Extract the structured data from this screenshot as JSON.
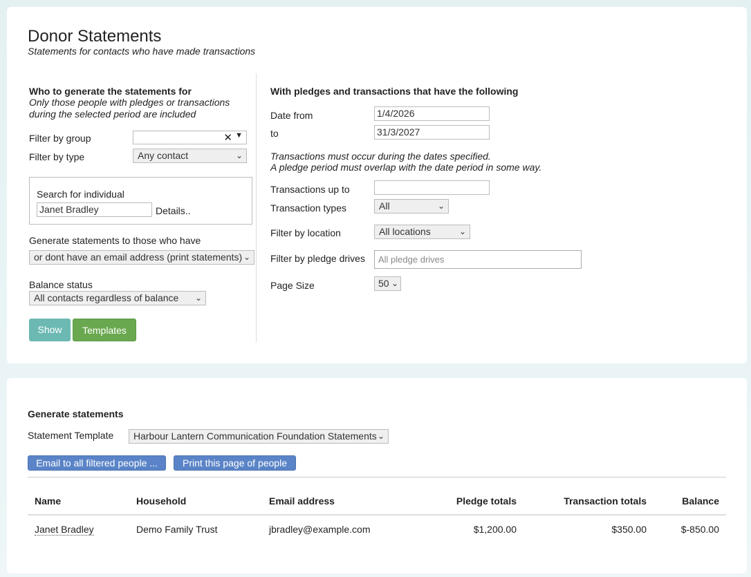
{
  "header": {
    "title": "Donor Statements",
    "subtitle": "Statements for contacts who have made transactions"
  },
  "left": {
    "section_title": "Who to generate the statements for",
    "note_line1": "Only those people with pledges or transactions",
    "note_line2": "during the selected period are included",
    "filter_group_label": "Filter by group",
    "filter_group_value": "",
    "filter_type_label": "Filter by type",
    "filter_type_value": "Any contact",
    "search_label": "Search for individual",
    "search_value": "Janet Bradley",
    "details_link": "Details..",
    "generate_label": "Generate statements to those who have",
    "generate_value": "or dont have an email address (print statements)",
    "balance_label": "Balance status",
    "balance_value": "All contacts regardless of balance",
    "show_button": "Show",
    "templates_button": "Templates"
  },
  "right": {
    "section_title": "With pledges and transactions that have the following",
    "date_from_label": "Date from",
    "date_from_value": "1/4/2026",
    "to_label": "to",
    "to_value": "31/3/2027",
    "note_line1": "Transactions must occur during the dates specified.",
    "note_line2": "A pledge period must overlap with the date period in some way.",
    "trans_up_to_label": "Transactions up to",
    "trans_up_to_value": "",
    "trans_types_label": "Transaction types",
    "trans_types_value": "All",
    "location_label": "Filter by location",
    "location_value": "All locations",
    "pledge_drives_label": "Filter by pledge drives",
    "pledge_drives_placeholder": "All pledge drives",
    "page_size_label": "Page Size",
    "page_size_value": "50"
  },
  "generate": {
    "section_title": "Generate statements",
    "template_label": "Statement Template",
    "template_value": "Harbour Lantern Communication Foundation Statements",
    "email_button": "Email to all filtered people ...",
    "print_button": "Print this page of people"
  },
  "table": {
    "headers": [
      "Name",
      "Household",
      "Email address",
      "Pledge totals",
      "Transaction totals",
      "Balance"
    ],
    "rows": [
      {
        "name": "Janet Bradley",
        "household": "Demo Family Trust",
        "email": "jbradley@example.com",
        "pledge": "$1,200.00",
        "transaction": "$350.00",
        "balance": "$-850.00"
      }
    ]
  },
  "icons": {
    "clear": "close-icon",
    "dropdown": "chevron-down-icon"
  }
}
